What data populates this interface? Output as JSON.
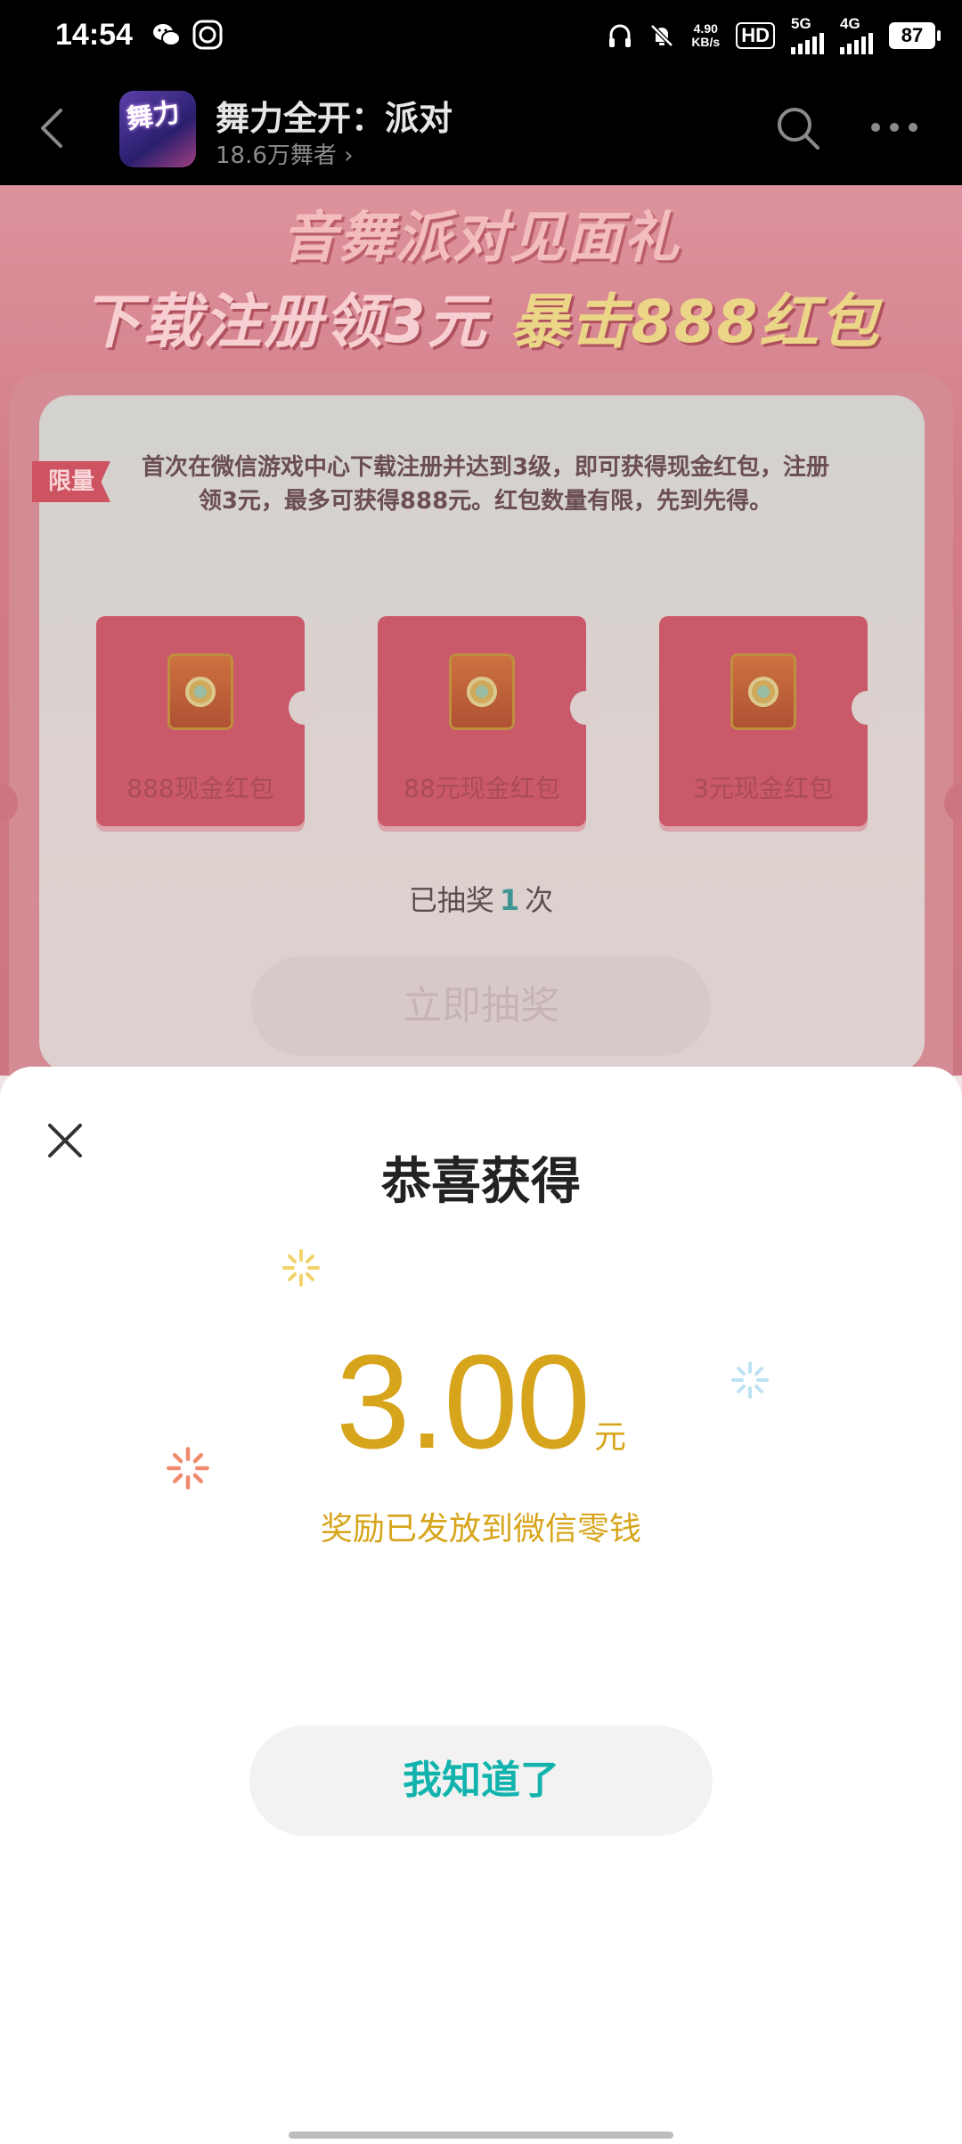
{
  "status_bar": {
    "time": "14:54",
    "net_speed_value": "4.90",
    "net_speed_unit": "KB/s",
    "hd_label": "HD",
    "sim1_label": "5G",
    "sim2_label": "4G",
    "battery": "87"
  },
  "header": {
    "app_title": "舞力全开：派对",
    "app_subtitle": "18.6万舞者",
    "app_icon_text": "舞力"
  },
  "promo": {
    "headline_line1": "音舞派对见面礼",
    "headline_line2_a": "下载注册领3元",
    "headline_line2_b": "暴击888红包",
    "limit_tag": "限量",
    "description": "首次在微信游戏中心下载注册并达到3级，即可获得现金红包，注册领3元，最多可获得888元。红包数量有限，先到先得。",
    "prizes": [
      {
        "label": "888现金红包"
      },
      {
        "label": "88元现金红包"
      },
      {
        "label": "3元现金红包"
      }
    ],
    "draw_count_prefix": "已抽奖",
    "draw_count": "1",
    "draw_count_suffix": "次",
    "draw_button": "立即抽奖"
  },
  "result_sheet": {
    "title": "恭喜获得",
    "amount": "3.00",
    "unit": "元",
    "note": "奖励已发放到微信零钱",
    "confirm_button": "我知道了"
  },
  "colors": {
    "accent_gold": "#d7a51b",
    "confirm_teal": "#12b3ad"
  }
}
